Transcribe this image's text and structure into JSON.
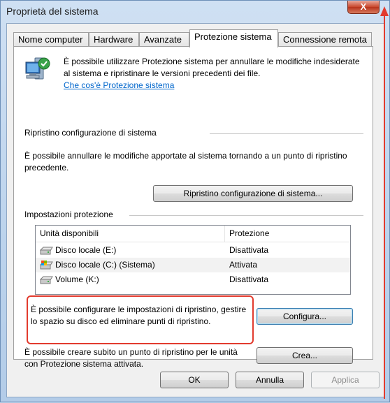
{
  "window": {
    "title": "Proprietà del sistema",
    "close_label": "X"
  },
  "tabs": [
    {
      "label": "Nome computer"
    },
    {
      "label": "Hardware"
    },
    {
      "label": "Avanzate"
    },
    {
      "label": "Protezione sistema"
    },
    {
      "label": "Connessione remota"
    }
  ],
  "intro": {
    "text": "È possibile utilizzare Protezione sistema per annullare le modifiche indesiderate al sistema e ripristinare le versioni precedenti dei file.",
    "link": "Che cos'è Protezione sistema"
  },
  "restore": {
    "title": "Ripristino configurazione di sistema",
    "description": "È possibile annullare le modifiche apportate al sistema tornando a un punto di ripristino precedente.",
    "button": "Ripristino configurazione di sistema..."
  },
  "protection": {
    "title": "Impostazioni protezione",
    "columns": [
      "Unità disponibili",
      "Protezione"
    ],
    "rows": [
      {
        "drive": "Disco locale (E:)",
        "status": "Disattivata",
        "icon": "hard-drive-icon"
      },
      {
        "drive": "Disco locale (C:) (Sistema)",
        "status": "Attivata",
        "icon": "system-drive-icon"
      },
      {
        "drive": "Volume (K:)",
        "status": "Disattivata",
        "icon": "hard-drive-icon"
      }
    ],
    "configure_text": "È possibile configurare le impostazioni di ripristino, gestire lo spazio su disco ed eliminare punti di ripristino.",
    "configure_button": "Configura...",
    "create_text": "È possibile creare subito un punto di ripristino per le unità con Protezione sistema attivata.",
    "create_button": "Crea..."
  },
  "footer": {
    "ok": "OK",
    "cancel": "Annulla",
    "apply": "Applica"
  },
  "colors": {
    "highlight": "#e23b2e",
    "link": "#0066cc"
  }
}
